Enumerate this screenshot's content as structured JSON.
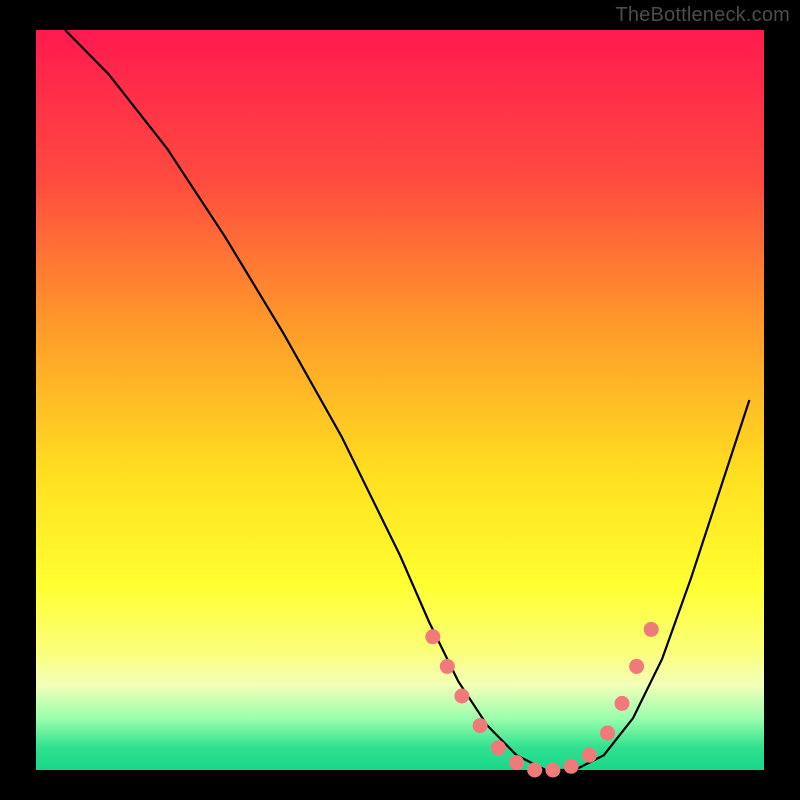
{
  "attribution": "TheBottleneck.com",
  "colors": {
    "background": "#000000",
    "gradient_stops": [
      {
        "offset": 0.0,
        "color": "#ff1a4f"
      },
      {
        "offset": 0.2,
        "color": "#ff4a3f"
      },
      {
        "offset": 0.4,
        "color": "#ff9a2a"
      },
      {
        "offset": 0.6,
        "color": "#ffdf20"
      },
      {
        "offset": 0.75,
        "color": "#ffff30"
      },
      {
        "offset": 0.84,
        "color": "#fbff7a"
      },
      {
        "offset": 0.885,
        "color": "#f3ffb8"
      },
      {
        "offset": 0.93,
        "color": "#9bffad"
      },
      {
        "offset": 0.97,
        "color": "#2fe08f"
      },
      {
        "offset": 1.0,
        "color": "#1ad78a"
      }
    ],
    "curve": "#000000",
    "marker_fill": "#f07a7a",
    "marker_stroke": "#d86060",
    "attribution_text": "#4c4c4c"
  },
  "chart_data": {
    "type": "line",
    "title": "",
    "xlabel": "",
    "ylabel": "",
    "xlim": [
      0,
      100
    ],
    "ylim": [
      0,
      100
    ],
    "grid": false,
    "series": [
      {
        "name": "bottleneck-curve",
        "x": [
          4,
          10,
          18,
          26,
          34,
          42,
          46,
          50,
          54,
          58,
          62,
          66,
          70,
          74,
          78,
          82,
          86,
          90,
          94,
          98
        ],
        "y": [
          100,
          94,
          84,
          72,
          59,
          45,
          37,
          29,
          20,
          12,
          6,
          2,
          0,
          0,
          2,
          7,
          15,
          26,
          38,
          50
        ]
      }
    ],
    "markers": {
      "name": "highlighted-points",
      "x": [
        54.5,
        56.5,
        58.5,
        61,
        63.5,
        66,
        68.5,
        71,
        73.5,
        76,
        78.5,
        80.5,
        82.5,
        84.5
      ],
      "y": [
        18,
        14,
        10,
        6,
        3,
        1,
        0,
        0,
        0.5,
        2,
        5,
        9,
        14,
        19
      ]
    }
  }
}
